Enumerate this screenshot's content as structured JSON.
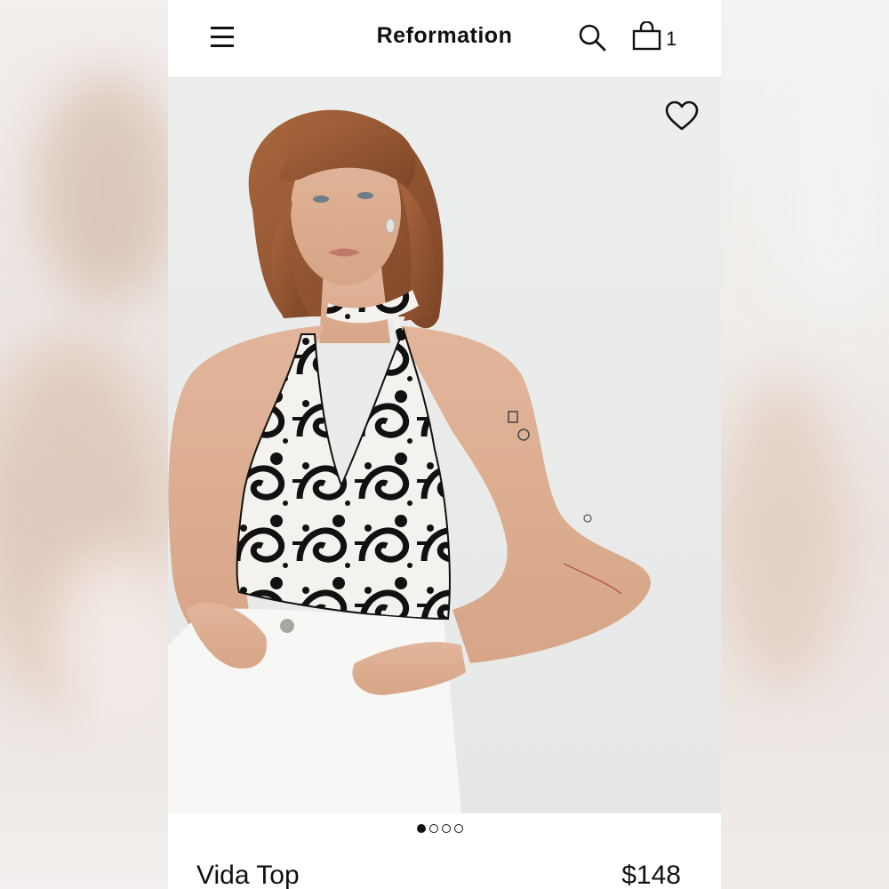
{
  "header": {
    "brand": "Reformation",
    "menu_icon": "hamburger-menu-icon",
    "search_icon": "search-icon",
    "bag_icon": "shopping-bag-icon",
    "bag_count": "1"
  },
  "hero": {
    "wishlist_icon": "heart-outline-icon",
    "carousel": {
      "total": 4,
      "active_index": 0
    }
  },
  "product": {
    "name": "Vida Top",
    "price": "$148"
  },
  "colors": {
    "text": "#111111",
    "background": "#ffffff",
    "photo_backdrop": "#eaeceb"
  }
}
